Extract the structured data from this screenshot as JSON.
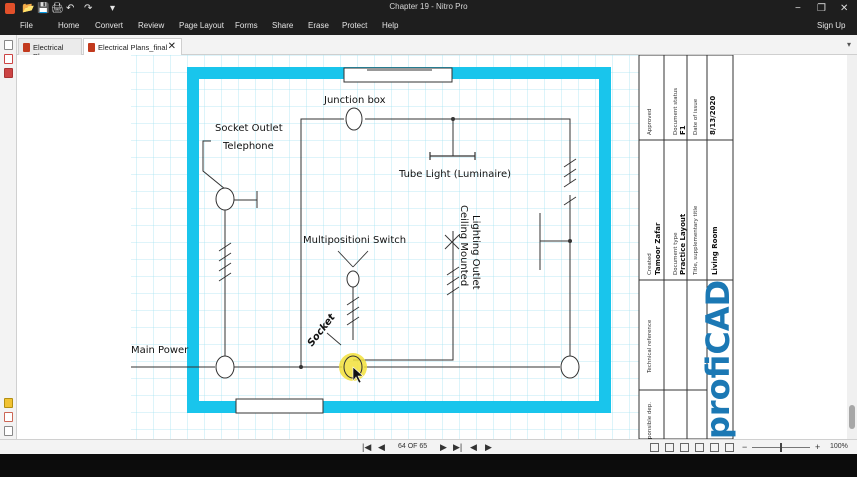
{
  "window": {
    "title": "Chapter 19 - Nitro Pro",
    "quick_access": [
      "📂",
      "💾",
      "🖨",
      "↶",
      "↷",
      "▾"
    ],
    "controls": {
      "minimize": "−",
      "restore": "❐",
      "close": "✕"
    }
  },
  "menu": {
    "items": [
      "File",
      "Home",
      "Convert",
      "Review",
      "Page Layout",
      "Forms",
      "Share",
      "Erase",
      "Protect",
      "Help"
    ],
    "signup": "Sign Up"
  },
  "tabs": [
    {
      "label": "Electrical Plans",
      "active": false
    },
    {
      "label": "Electrical Plans_final",
      "active": true,
      "close": "✕"
    }
  ],
  "drawing": {
    "labels": {
      "junction_box": "Junction box",
      "socket_outlet": "Socket Outlet",
      "telephone": "Telephone",
      "tube_light": "Tube Light (Luminaire)",
      "multiposition_switch": "Multipositioni Switch",
      "lighting_outlet_1": "Lighting Outlet",
      "lighting_outlet_2": "Ceiling Mounted",
      "main_power": "Main Power",
      "socket": "Socket"
    },
    "title_block": {
      "approved": "Approved",
      "document_status": "Document status",
      "date_of_issue": "Date of issue",
      "date_value": "8/13/2020",
      "sheet": "F1",
      "created_label": "Created",
      "created_by": "Tamoor Zafar",
      "document_type_label": "Document type",
      "document_type": "Practice Layout",
      "title_label": "Title, supplementary title",
      "title_value": "Living Room",
      "technical_reference": "Technical reference",
      "responsible_dept": "ponsible dep.",
      "logo": "profiCAD"
    }
  },
  "statusbar": {
    "page_indicator": "64 OF 65",
    "zoom": "100%",
    "zoom_minus": "−",
    "zoom_plus": "+"
  },
  "colors": {
    "wall": "#19c5ec",
    "grid": "#a6e4f2",
    "highlight": "#f2e13a",
    "chrome": "#1e1e1e"
  }
}
